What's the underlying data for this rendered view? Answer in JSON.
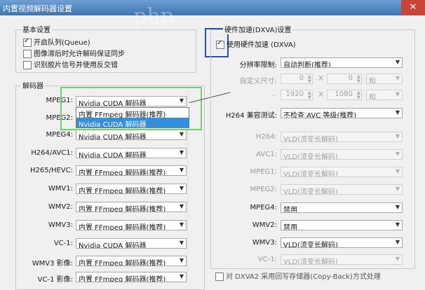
{
  "window": {
    "title": "内置视频解码器设置",
    "watermark": "php"
  },
  "basic": {
    "legend": "基本设置",
    "options": [
      {
        "label": "开启队列(Queue)",
        "checked": true
      },
      {
        "label": "图像滞后时允许解码保证同步",
        "checked": false
      },
      {
        "label": "识别胶片信号并使用反交错",
        "checked": false
      }
    ]
  },
  "decoders": {
    "legend": "解码器",
    "rows": [
      {
        "label": "MPEG1:",
        "value": "Nvidia CUDA 解码器"
      },
      {
        "label": "MPEG2:",
        "value": ""
      },
      {
        "label": "MPEG4:",
        "value": "Nvidia CUDA 解码器"
      },
      {
        "label": "H264/AVC1:",
        "value": "Nvidia CUDA 解码器"
      },
      {
        "label": "H265/HEVC:",
        "value": "内置 FFmpeg 解码器(推荐)"
      },
      {
        "label": "WMV1:",
        "value": "内置 FFmpeg 解码器(推荐)"
      },
      {
        "label": "WMV2:",
        "value": "内置 FFmpeg 解码器(推荐)"
      },
      {
        "label": "WMV3:",
        "value": "内置 FFmpeg 解码器(推荐)"
      },
      {
        "label": "VC-1:",
        "value": "Nvidia CUDA 解码器"
      },
      {
        "label": "WMV3 影像:",
        "value": "内置 FFmpeg 解码器(推荐)"
      },
      {
        "label": "VC-1 影像:",
        "value": "内置 FFmpeg 解码器(推荐)"
      }
    ],
    "dropdown_options": [
      {
        "label": "内置 FFmpeg 解码器(推荐)",
        "selected": false
      },
      {
        "label": "Nvidia CUDA 解码器",
        "selected": true
      }
    ]
  },
  "hw": {
    "legend": "硬件加速(DXVA)设置",
    "enable_label": "使用硬件加速 (DXVA)",
    "enable_checked": true,
    "resolution_label": "分辨率限制:",
    "resolution_value": "自动判断(推荐)",
    "custom_size_label": "自定义尺寸:",
    "custom_w": "0",
    "custom_h": "0",
    "custom_unit": "和",
    "range_w": "1920",
    "range_h": "1080",
    "range_unit": "和",
    "x_sep": "X",
    "h264_compat_label": "H264 兼容测试:",
    "h264_compat_value": "不检查 AVC 等级(推荐)",
    "codecs": [
      {
        "label": "H264:",
        "value": "VLD(流变长解码)",
        "disabled": true
      },
      {
        "label": "AVC1:",
        "value": "VLD(流变长解码)",
        "disabled": true
      },
      {
        "label": "MPEG1:",
        "value": "VLD(流变长解码)",
        "disabled": true
      },
      {
        "label": "MPEG2:",
        "value": "VLD(流变长解码)",
        "disabled": true
      },
      {
        "label": "MPEG4:",
        "value": "禁用",
        "disabled": false
      },
      {
        "label": "WMV2:",
        "value": "禁用",
        "disabled": false
      },
      {
        "label": "WMV3:",
        "value": "VLD(流变长解码)",
        "disabled": false
      },
      {
        "label": "VC-1:",
        "value": "VLD(流变长解码)",
        "disabled": true
      }
    ],
    "copyback_label": "对 DXVA2 采用回写存储器(Copy-Back)方式处理",
    "copyback_checked": false
  }
}
